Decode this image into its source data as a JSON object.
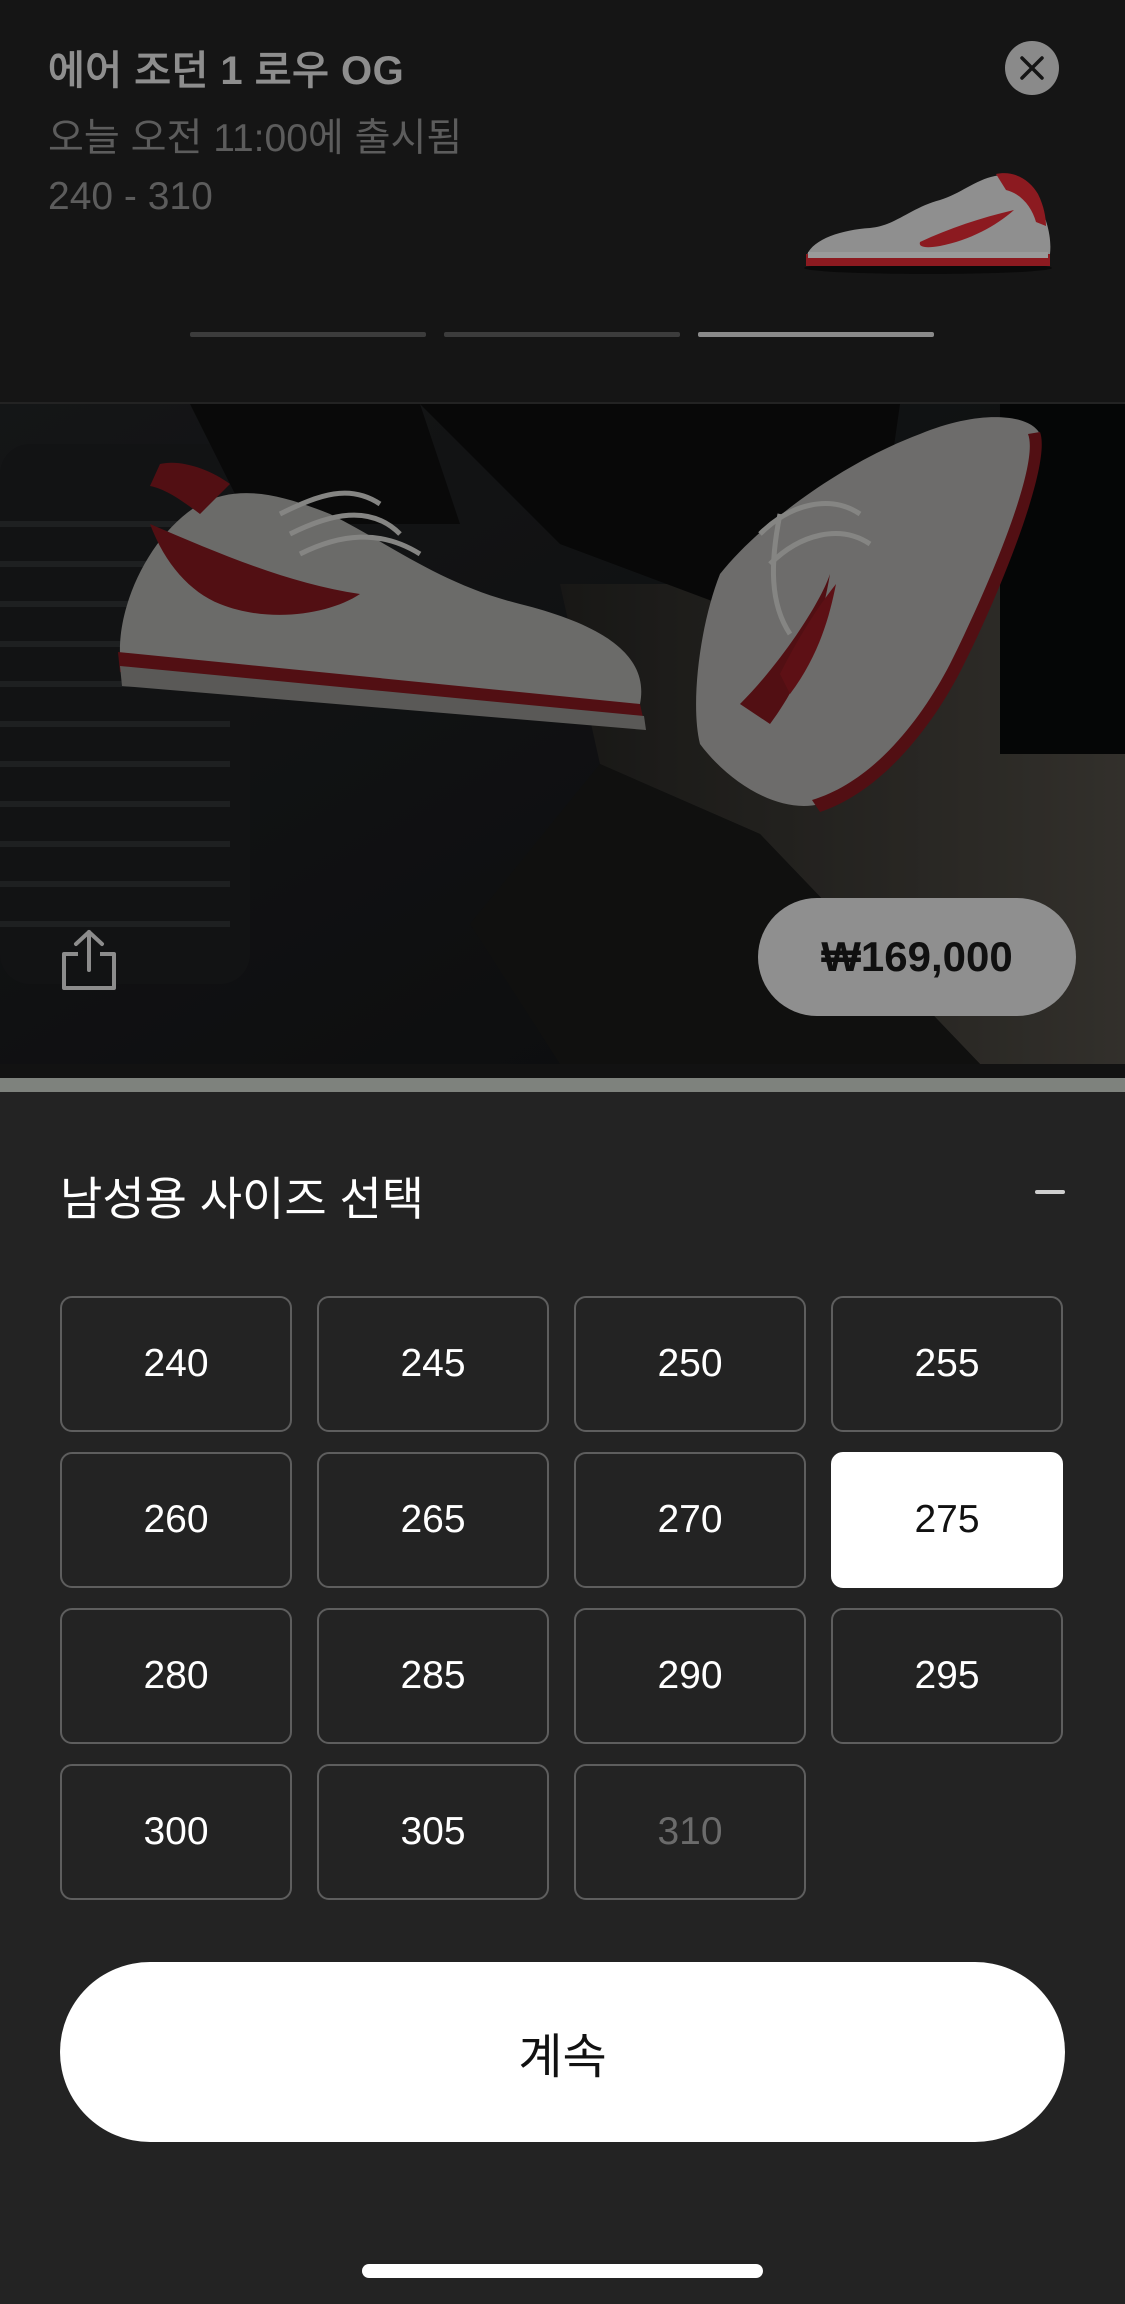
{
  "header": {
    "product_title": "에어 조던 1 로우 OG",
    "release_text": "오늘 오전 11:00에 출시됨",
    "size_range": "240 - 310",
    "progress_segments": [
      {
        "active": false
      },
      {
        "active": false
      },
      {
        "active": true
      }
    ]
  },
  "hero": {
    "price": "₩169,000"
  },
  "size_sheet": {
    "title": "남성용 사이즈 선택",
    "sizes": [
      {
        "label": "240",
        "state": "available"
      },
      {
        "label": "245",
        "state": "available"
      },
      {
        "label": "250",
        "state": "available"
      },
      {
        "label": "255",
        "state": "available"
      },
      {
        "label": "260",
        "state": "available"
      },
      {
        "label": "265",
        "state": "available"
      },
      {
        "label": "270",
        "state": "available"
      },
      {
        "label": "275",
        "state": "selected"
      },
      {
        "label": "280",
        "state": "available"
      },
      {
        "label": "285",
        "state": "available"
      },
      {
        "label": "290",
        "state": "available"
      },
      {
        "label": "295",
        "state": "available"
      },
      {
        "label": "300",
        "state": "available"
      },
      {
        "label": "305",
        "state": "available"
      },
      {
        "label": "310",
        "state": "disabled"
      }
    ],
    "continue_label": "계속"
  },
  "colors": {
    "sheet_background": "#232323",
    "header_background": "#151515",
    "selected_fill": "#ffffff",
    "price_pill": "#8f8f8f",
    "shoe_red": "#b51d26"
  },
  "icons": {
    "close": "close-icon",
    "share": "share-icon",
    "collapse": "minus-icon"
  }
}
